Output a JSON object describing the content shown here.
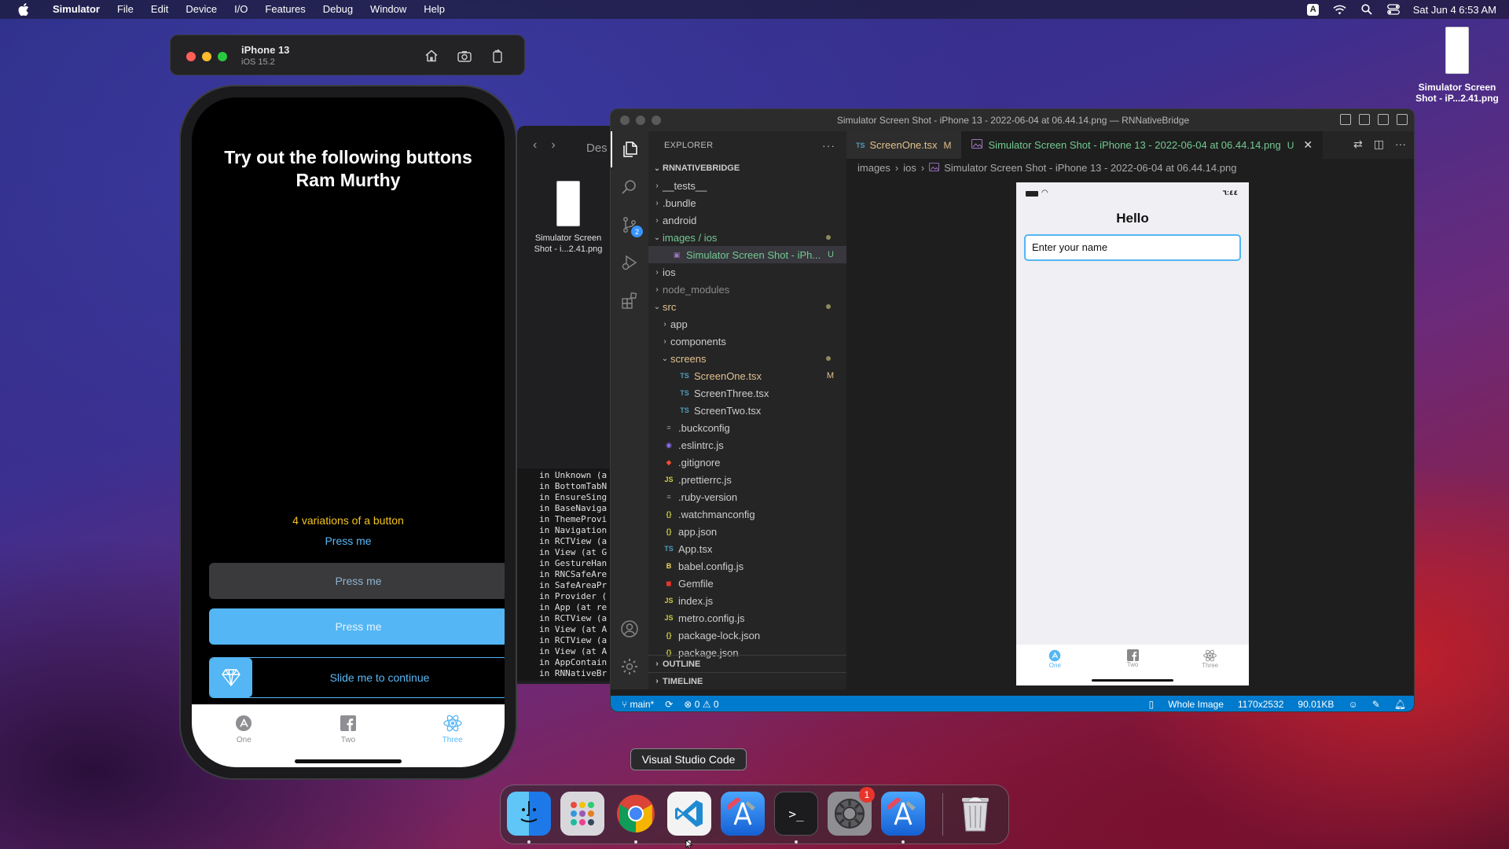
{
  "menubar": {
    "app": "Simulator",
    "items": [
      "File",
      "Edit",
      "Device",
      "I/O",
      "Features",
      "Debug",
      "Window",
      "Help"
    ],
    "input_source": "A",
    "datetime": "Sat Jun 4  6:53 AM"
  },
  "simulator": {
    "device_name": "iPhone 13",
    "os_version": "iOS 15.2"
  },
  "phone": {
    "title": "Try out the following buttons Ram Murthy",
    "subtitle": "4 variations of a button",
    "text_button": "Press me",
    "gray_button": "Press me",
    "blue_button": "Press me",
    "slider_label": "Slide me to continue",
    "tabs": [
      "One",
      "Two",
      "Three"
    ],
    "active_tab": "Three"
  },
  "finder": {
    "crumb": "Des",
    "file_name_line1": "Simulator Screen",
    "file_name_line2": "Shot - i...2.41.png"
  },
  "console": {
    "lines": [
      "in Unknown (a",
      "in BottomTabN",
      "in EnsureSing",
      "in BaseNaviga",
      "in ThemeProvi",
      "in Navigation",
      "in RCTView (a",
      "in View (at G",
      "in GestureHan",
      "in RNCSafeAre",
      "in SafeAreaPr",
      "in Provider (",
      "in App (at re",
      "in RCTView (a",
      "in View (at A",
      "in RCTView (a",
      "in View (at A",
      "in AppContain",
      "in RNNativeBr"
    ]
  },
  "vscode": {
    "window_title": "Simulator Screen Shot - iPhone 13 - 2022-06-04 at 06.44.14.png — RNNativeBridge",
    "explorer_label": "EXPLORER",
    "project": "RNNATIVEBRIDGE",
    "source_control_badge": "2",
    "tree": [
      {
        "label": "__tests__",
        "indent": 1,
        "chevron": "›",
        "icon": "",
        "color": "normal",
        "mark": ""
      },
      {
        "label": ".bundle",
        "indent": 1,
        "chevron": "›",
        "icon": "",
        "color": "normal",
        "mark": ""
      },
      {
        "label": "android",
        "indent": 1,
        "chevron": "›",
        "icon": "",
        "color": "normal",
        "mark": ""
      },
      {
        "label": "images / ios",
        "indent": 1,
        "chevron": "⌄",
        "icon": "",
        "color": "green",
        "mark": "dot"
      },
      {
        "label": "Simulator Screen Shot - iPh...",
        "indent": 2,
        "chevron": "",
        "icon": "img",
        "color": "green",
        "mark": "U",
        "selected": true
      },
      {
        "label": "ios",
        "indent": 1,
        "chevron": "›",
        "icon": "",
        "color": "normal",
        "mark": ""
      },
      {
        "label": "node_modules",
        "indent": 1,
        "chevron": "›",
        "icon": "",
        "color": "dim",
        "mark": ""
      },
      {
        "label": "src",
        "indent": 1,
        "chevron": "⌄",
        "icon": "",
        "color": "yellow",
        "mark": "dot"
      },
      {
        "label": "app",
        "indent": 2,
        "chevron": "›",
        "icon": "",
        "color": "normal",
        "mark": ""
      },
      {
        "label": "components",
        "indent": 2,
        "chevron": "›",
        "icon": "",
        "color": "normal",
        "mark": ""
      },
      {
        "label": "screens",
        "indent": 2,
        "chevron": "⌄",
        "icon": "",
        "color": "yellow",
        "mark": "dot"
      },
      {
        "label": "ScreenOne.tsx",
        "indent": 3,
        "chevron": "",
        "icon": "TS",
        "color": "yellow",
        "mark": "M"
      },
      {
        "label": "ScreenThree.tsx",
        "indent": 3,
        "chevron": "",
        "icon": "TS",
        "color": "normal",
        "mark": ""
      },
      {
        "label": "ScreenTwo.tsx",
        "indent": 3,
        "chevron": "",
        "icon": "TS",
        "color": "normal",
        "mark": ""
      },
      {
        "label": ".buckconfig",
        "indent": 1,
        "chevron": "",
        "icon": "≡",
        "color": "normal",
        "mark": ""
      },
      {
        "label": ".eslintrc.js",
        "indent": 1,
        "chevron": "",
        "icon": "◉",
        "color": "normal",
        "mark": ""
      },
      {
        "label": ".gitignore",
        "indent": 1,
        "chevron": "",
        "icon": "◆",
        "color": "normal",
        "mark": ""
      },
      {
        "label": ".prettierrc.js",
        "indent": 1,
        "chevron": "",
        "icon": "JS",
        "color": "normal",
        "mark": ""
      },
      {
        "label": ".ruby-version",
        "indent": 1,
        "chevron": "",
        "icon": "≡",
        "color": "normal",
        "mark": ""
      },
      {
        "label": ".watchmanconfig",
        "indent": 1,
        "chevron": "",
        "icon": "{}",
        "color": "normal",
        "mark": ""
      },
      {
        "label": "app.json",
        "indent": 1,
        "chevron": "",
        "icon": "{}",
        "color": "normal",
        "mark": ""
      },
      {
        "label": "App.tsx",
        "indent": 1,
        "chevron": "",
        "icon": "TS",
        "color": "normal",
        "mark": ""
      },
      {
        "label": "babel.config.js",
        "indent": 1,
        "chevron": "",
        "icon": "B",
        "color": "normal",
        "mark": ""
      },
      {
        "label": "Gemfile",
        "indent": 1,
        "chevron": "",
        "icon": "◼",
        "color": "normal",
        "mark": ""
      },
      {
        "label": "index.js",
        "indent": 1,
        "chevron": "",
        "icon": "JS",
        "color": "normal",
        "mark": ""
      },
      {
        "label": "metro.config.js",
        "indent": 1,
        "chevron": "",
        "icon": "JS",
        "color": "normal",
        "mark": ""
      },
      {
        "label": "package-lock.json",
        "indent": 1,
        "chevron": "",
        "icon": "{}",
        "color": "normal",
        "mark": ""
      },
      {
        "label": "package.json",
        "indent": 1,
        "chevron": "",
        "icon": "{}",
        "color": "normal",
        "mark": ""
      }
    ],
    "outline_label": "OUTLINE",
    "timeline_label": "TIMELINE",
    "tabs": [
      {
        "label": "ScreenOne.tsx",
        "flag": "M",
        "active": false
      },
      {
        "label": "Simulator Screen Shot - iPhone 13 - 2022-06-04 at 06.44.14.png",
        "flag": "U",
        "active": true
      }
    ],
    "breadcrumb": [
      "images",
      "ios",
      "Simulator Screen Shot - iPhone 13 - 2022-06-04 at 06.44.14.png"
    ],
    "preview": {
      "status_time": "٦:٤٤",
      "heading": "Hello",
      "input_placeholder": "Enter your name",
      "tabs": [
        "One",
        "Two",
        "Three"
      ]
    },
    "status": {
      "branch": "main*",
      "errors": "0",
      "warnings": "0",
      "view_mode": "Whole Image",
      "dimensions": "1170x2532",
      "size": "90.01KB"
    }
  },
  "desktop_icon": {
    "line1": "Simulator Screen",
    "line2": "Shot - iP...2.41.png"
  },
  "dock": {
    "tooltip": "Visual Studio Code",
    "settings_badge": "1",
    "apps": [
      "finder",
      "launchpad",
      "chrome",
      "vscode",
      "xcode-beta",
      "terminal",
      "system-preferences",
      "xcode",
      "trash"
    ]
  },
  "colors": {
    "accent": "#54b6f4",
    "vscode_status": "#007acc",
    "git_modified": "#e2c08d",
    "git_untracked": "#73c991",
    "subtitle_yellow": "#f2c41d"
  }
}
